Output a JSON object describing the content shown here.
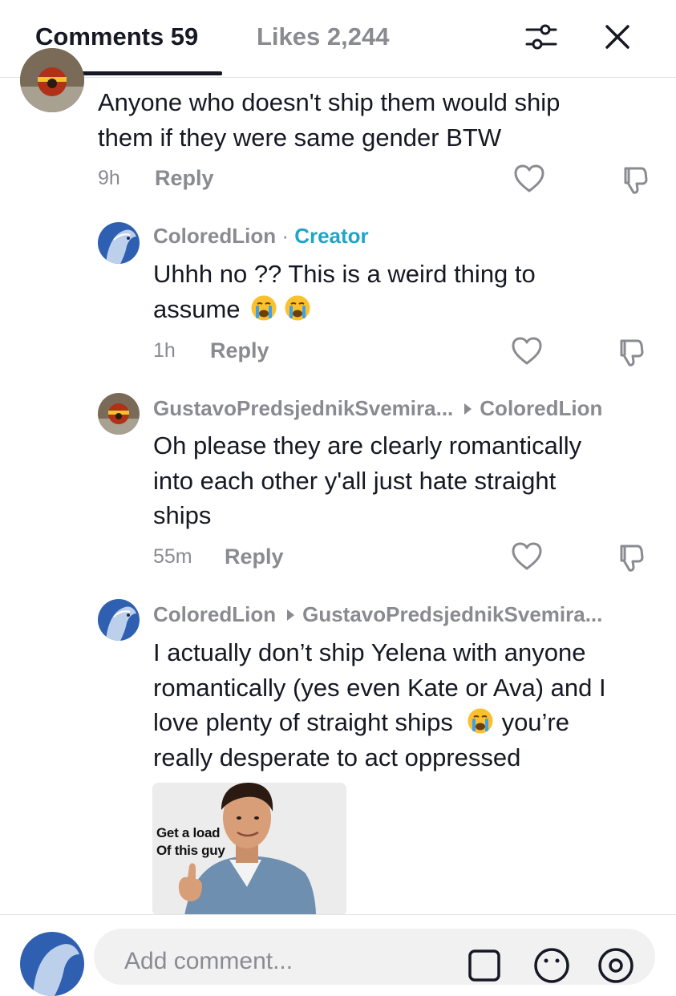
{
  "header": {
    "comments_tab": "Comments 59",
    "likes_tab": "Likes 2,244"
  },
  "comments": [
    {
      "text": "Anyone who doesn't ship them would ship them if they were same gender BTW",
      "line1": "Anyone who doesn't ship them would ship",
      "line2": "them if they were same gender BTW",
      "time": "9h",
      "reply": "Reply"
    },
    {
      "username": "ColoredLion",
      "separator": " · ",
      "badge": "Creator",
      "line1": "Uhhh no ?? This is a weird thing to",
      "line2": "assume",
      "time": "1h",
      "reply": "Reply"
    },
    {
      "username": "GustavoPredsjednikSvemira...",
      "reply_to": "ColoredLion",
      "line1": "Oh please they are clearly romantically",
      "line2": "into each other y'all just hate straight",
      "line3": "ships",
      "time": "55m",
      "reply": "Reply"
    },
    {
      "username": "ColoredLion",
      "reply_to": "GustavoPredsjednikSvemira...",
      "line1": "I actually don’t ship Yelena with anyone",
      "line2": "romantically (yes even Kate or Ava) and I",
      "line3a": "love plenty of straight ships",
      "line3b": "you’re",
      "line4": "really desperate to act oppressed",
      "gif_caption_1": "Get a load",
      "gif_caption_2": "Of this guy"
    }
  ],
  "input": {
    "placeholder": "Add comment..."
  },
  "colors": {
    "text": "#161823",
    "muted": "#8a8b91",
    "creator": "#20a5c8",
    "accent": "#f5c542"
  },
  "icons": [
    "filter-icon",
    "close-icon",
    "heart-icon",
    "dislike-icon",
    "crying-emoji",
    "image-icon",
    "emoji-icon",
    "mention-icon"
  ]
}
